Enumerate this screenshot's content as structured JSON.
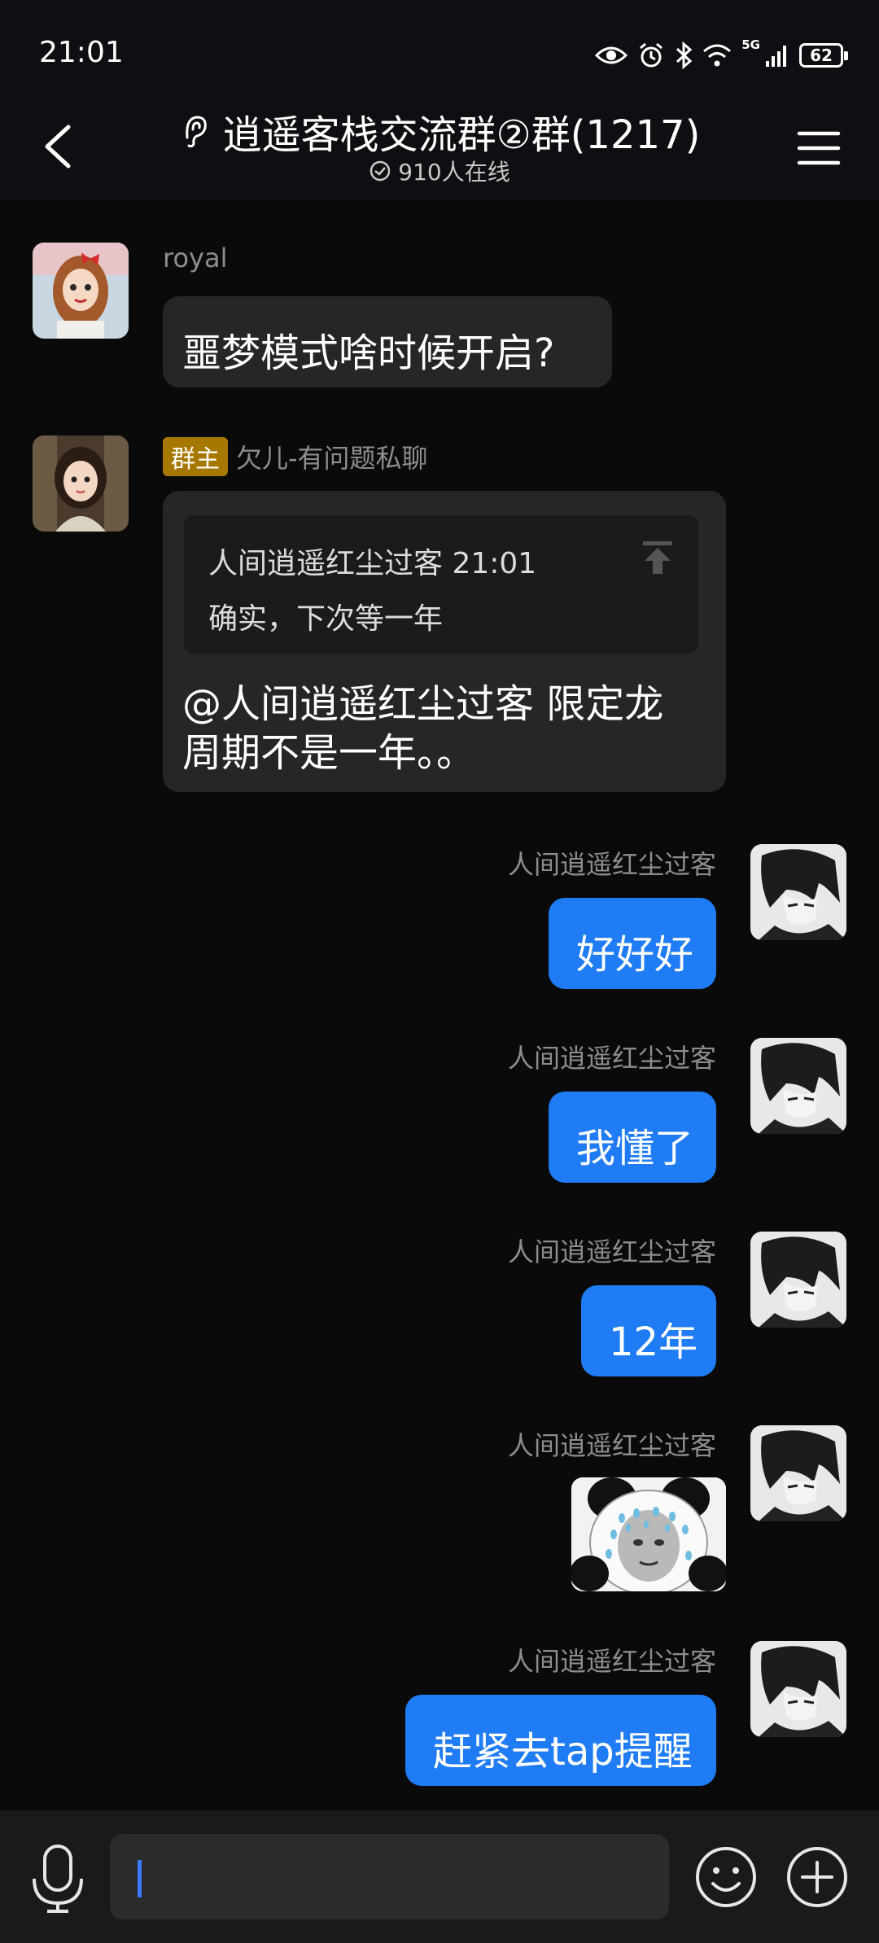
{
  "status": {
    "time": "21:01",
    "network": "5G",
    "battery": "62"
  },
  "header": {
    "title": "逍遥客栈交流群②群(1217)",
    "online": "910人在线"
  },
  "messages": [
    {
      "sender": "royal",
      "text": "噩梦模式啥时候开启?"
    },
    {
      "badge": "群主",
      "sender": "欠儿-有问题私聊",
      "quote_head": "人间逍遥红尘过客 21:01",
      "quote_body": "确实，下次等一年",
      "line1": "@人间逍遥红尘过客 限定龙",
      "line2": "周期不是一年。。"
    },
    {
      "sender": "人间逍遥红尘过客",
      "text": "好好好"
    },
    {
      "sender": "人间逍遥红尘过客",
      "text": "我懂了"
    },
    {
      "sender": "人间逍遥红尘过客",
      "text": "12年"
    },
    {
      "sender": "人间逍遥红尘过客",
      "sticker": "panda-sticker"
    },
    {
      "sender": "人间逍遥红尘过客",
      "text": "赶紧去tap提醒"
    }
  ],
  "icons": {
    "back": "back-arrow-icon",
    "ear": "ear-icon",
    "menu": "menu-icon",
    "mic": "microphone-icon",
    "emoji": "emoji-icon",
    "plus": "plus-icon"
  },
  "colors": {
    "bubble_self": "#1f7cf4",
    "bubble_other": "#262626",
    "owner_badge": "#a77800",
    "background": "#0a0a0a"
  }
}
